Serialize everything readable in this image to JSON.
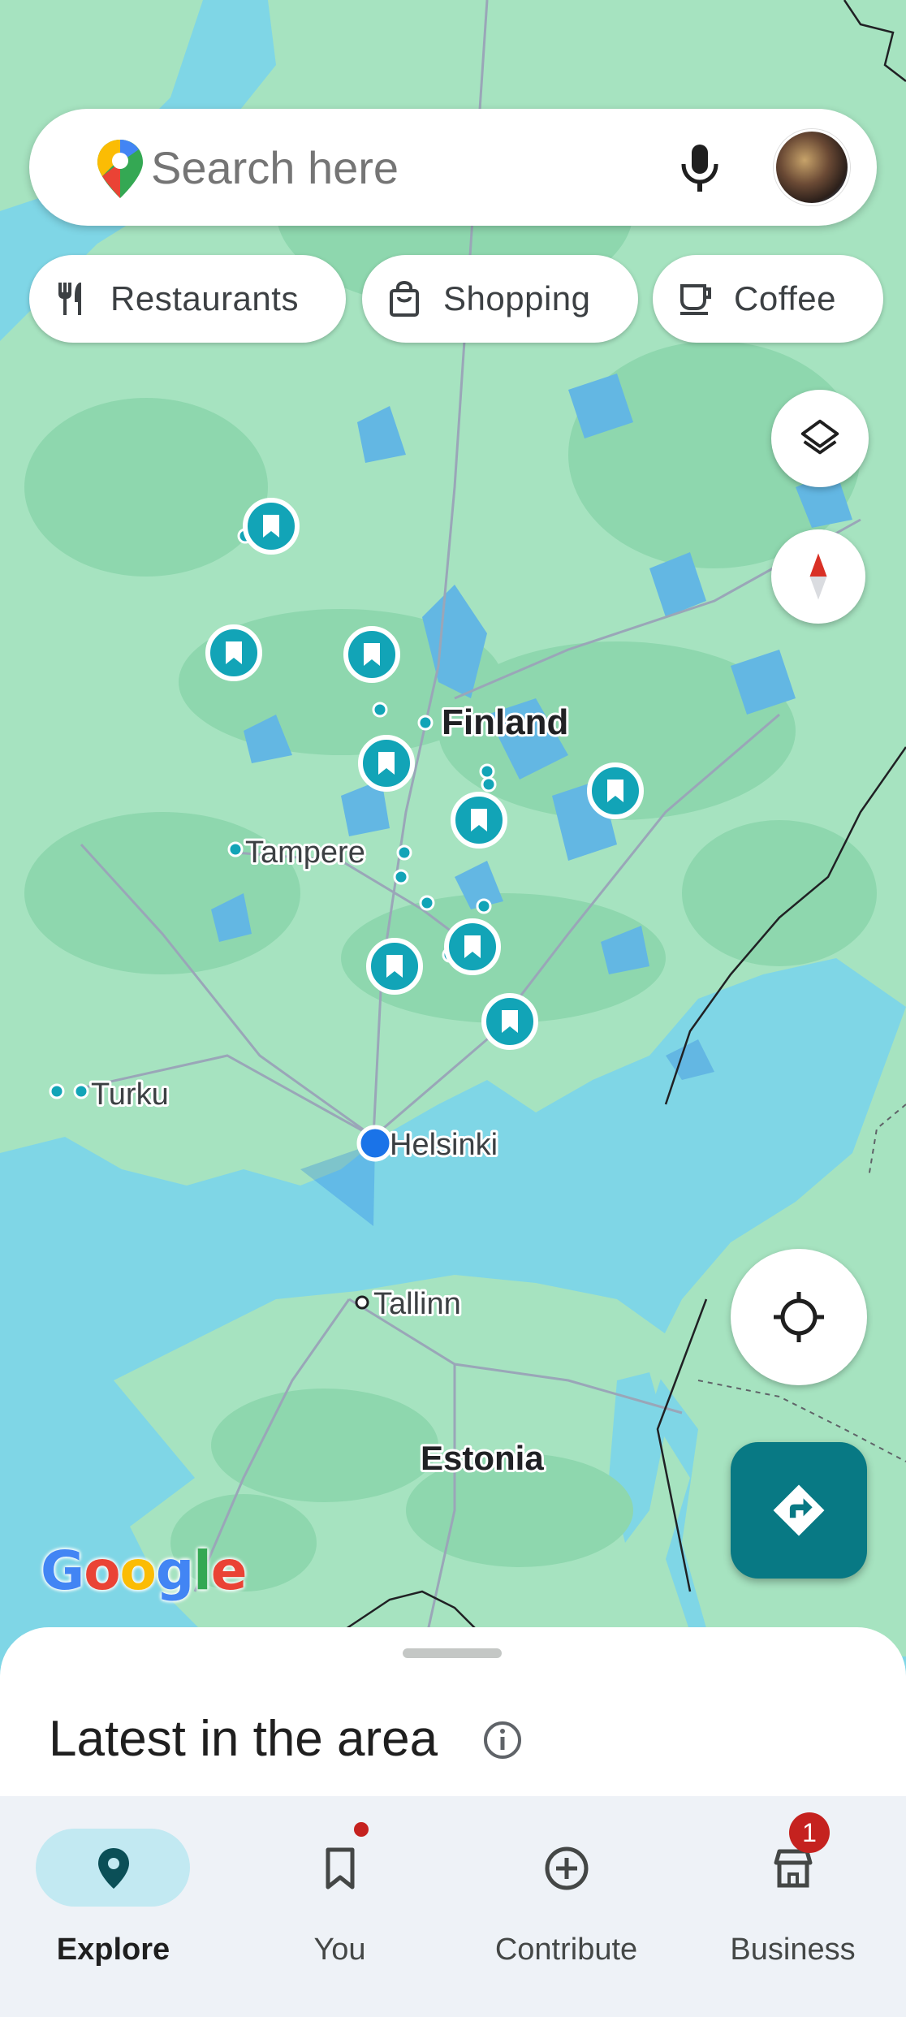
{
  "search": {
    "placeholder": "Search here"
  },
  "chips": [
    {
      "label": "Restaurants",
      "icon": "fork-knife-icon"
    },
    {
      "label": "Shopping",
      "icon": "shopping-bag-icon"
    },
    {
      "label": "Coffee",
      "icon": "coffee-cup-icon"
    }
  ],
  "map": {
    "labels": {
      "finland": "Finland",
      "tampere": "Tampere",
      "turku": "Turku",
      "helsinki": "Helsinki",
      "tallinn": "Tallinn",
      "estonia": "Estonia"
    },
    "colors": {
      "water": "#7fd6e6",
      "land": "#a8e2c2",
      "forest": "#8fd8ad",
      "saved_pin": "#12a4b7",
      "location": "#1a73e8",
      "directions": "#087984"
    }
  },
  "sheet": {
    "title": "Latest in the area"
  },
  "nav": {
    "explore": "Explore",
    "you": "You",
    "contribute": "Contribute",
    "business": "Business",
    "business_badge": "1"
  }
}
